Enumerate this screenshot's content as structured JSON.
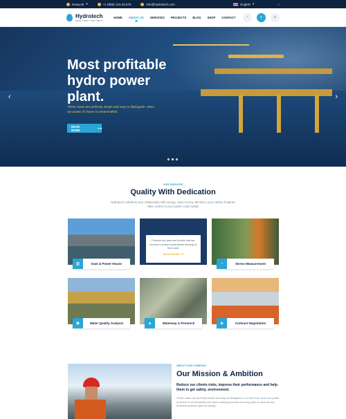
{
  "topbar": {
    "location": "Newyork",
    "phone": "+1 (888) 123.45.678",
    "email": "info@hydrotech.com",
    "language": "English"
  },
  "header": {
    "logo_name": "Hydrotech",
    "logo_tagline": "Need Power? Well Cam It",
    "nav": [
      "HOME",
      "ABOUT US",
      "SERVICES",
      "PROJECTS",
      "BLOG",
      "SHOP",
      "CONTACT"
    ],
    "active_nav": "ABOUT US"
  },
  "hero": {
    "title": "Most profitable hydro power plant.",
    "text": "These cases are perfectly simple and easy to distinguish. when our power of choice is untrammelled.",
    "button": "READ MORE",
    "slides": 3,
    "active_slide": 2
  },
  "services": {
    "eyebrow": "OUR SERVICES",
    "title": "Quality With Dedication",
    "description": "Hydrotech redefines your relationship with energy. Save money. Minimize your carbon footprint. Take control of your power costs today!",
    "cards": [
      {
        "label": "Dam & Power House"
      },
      {
        "label": "",
        "hover_text": "Foresee the pain and trouble that are bounds to ensue equal blame belongs to then duty.",
        "hover_link": "READ MORE"
      },
      {
        "label": "Stress Measurement"
      },
      {
        "label": "Water Quality Analysis"
      },
      {
        "label": "Waterway & Penstock"
      },
      {
        "label": "Contract Negotiation"
      }
    ]
  },
  "mission": {
    "eyebrow": "ABOUT OUR COMPANY",
    "title": "Our Mission & Ambition",
    "lead": "Reduce our clients risks, improve their performance and help them to get safety, environment.",
    "text": "These cases are perfectly simple and easy to distinguish. In a free hour, when our power of choice is untrammelled and when nothing prevents our being able do what we like business pleasure gets no saying."
  },
  "colors": {
    "accent": "#2aa6d6",
    "navy": "#0c2340",
    "gold": "#f3b73a"
  }
}
